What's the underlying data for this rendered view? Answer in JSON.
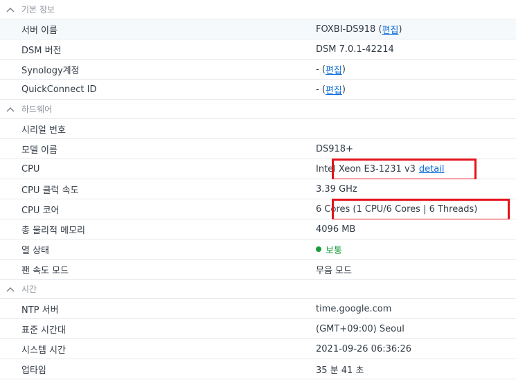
{
  "sections": {
    "basic": {
      "title": "기본 정보",
      "rows": [
        {
          "label": "서버 이름",
          "value": "FOXBI-DS918",
          "paren_open": " (",
          "link": "편집",
          "paren_close": ")"
        },
        {
          "label": "DSM 버전",
          "value": "DSM 7.0.1-42214"
        },
        {
          "label": "Synology계정",
          "value": "-",
          "paren_open": " (",
          "link": "편집",
          "paren_close": ")"
        },
        {
          "label": "QuickConnect ID",
          "value": "-",
          "paren_open": " (",
          "link": "편집",
          "paren_close": ")"
        }
      ]
    },
    "hardware": {
      "title": "하드웨어",
      "rows": [
        {
          "label": "시리얼 번호",
          "value": ""
        },
        {
          "label": "모델 이름",
          "value": "DS918+"
        },
        {
          "label": "CPU",
          "value": "Intel Xeon E3-1231 v3",
          "link": "detail"
        },
        {
          "label": "CPU 클럭 속도",
          "value": "3.39 GHz"
        },
        {
          "label": "CPU 코어",
          "value": "6 Cores (1 CPU/6 Cores | 6 Threads)"
        },
        {
          "label": "총 물리적 메모리",
          "value": "4096 MB"
        },
        {
          "label": "열 상태",
          "value": "보통"
        },
        {
          "label": "팬 속도 모드",
          "value": "무음 모드"
        }
      ]
    },
    "time": {
      "title": "시간",
      "rows": [
        {
          "label": "NTP 서버",
          "value": "time.google.com"
        },
        {
          "label": "표준 시간대",
          "value": "(GMT+09:00) Seoul"
        },
        {
          "label": "시스템 시간",
          "value": "2021-09-26 06:36:26"
        },
        {
          "label": "업타임",
          "value": "35 분 41 초"
        }
      ]
    }
  },
  "colors": {
    "link": "#0a6cdb",
    "status_ok": "#1a9e3c",
    "highlight": "#e3121b"
  },
  "icons": {
    "section_toggle": "chevron-up-icon",
    "status": "status-dot-icon"
  }
}
